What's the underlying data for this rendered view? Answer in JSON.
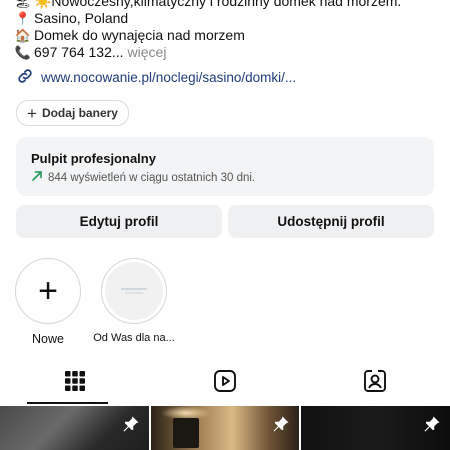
{
  "bio": {
    "lines": [
      {
        "icon": "sun-beach-emoji",
        "text": "☀️Nowoczesny,klimatyczny i rodzinny domek nad morzem."
      },
      {
        "icon": "location-pin-emoji",
        "text": "Sasino, Poland"
      },
      {
        "icon": "house-emoji",
        "text": "Domek do wynajęcia nad morzem"
      },
      {
        "icon": "phone-emoji",
        "text": "697 764 132..."
      }
    ],
    "more_label": "więcej",
    "link": "www.nocowanie.pl/noclegi/sasino/domki/..."
  },
  "chip": {
    "label": "Dodaj banery"
  },
  "dashboard": {
    "title": "Pulpit profesjonalny",
    "subtitle": "844 wyświetleń w ciągu ostatnich 30 dni."
  },
  "buttons": {
    "edit": "Edytuj profil",
    "share": "Udostępnij profil"
  },
  "highlights": [
    {
      "label": "Nowe"
    },
    {
      "label": "Od Was dla na..."
    }
  ],
  "tabs": [
    {
      "name": "grid",
      "icon": "grid-icon",
      "active": true
    },
    {
      "name": "reels",
      "icon": "reels-icon",
      "active": false
    },
    {
      "name": "tagged",
      "icon": "tagged-person-icon",
      "active": false
    }
  ],
  "colors": {
    "link": "#1f3d7a",
    "muted": "#8a8a8a",
    "panel": "#f3f4f5",
    "button": "#eff0f2"
  }
}
